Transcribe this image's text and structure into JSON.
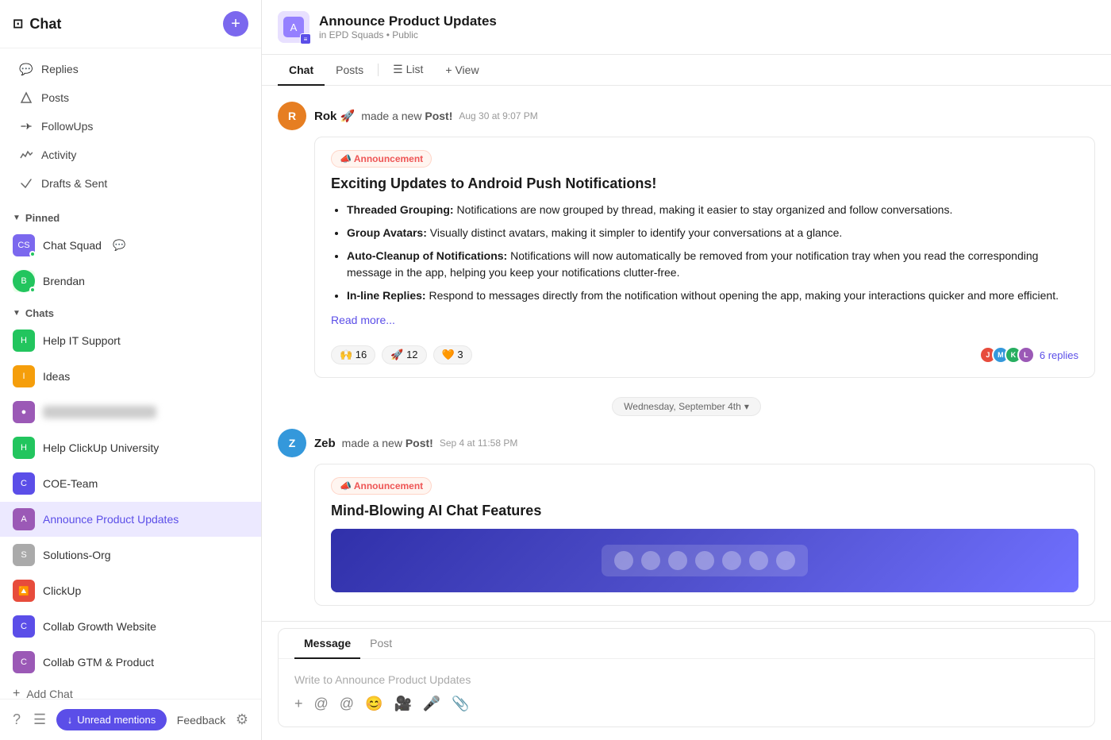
{
  "sidebar": {
    "title": "Chat",
    "add_button_label": "+",
    "nav_items": [
      {
        "id": "replies",
        "label": "Replies",
        "icon": "💬"
      },
      {
        "id": "posts",
        "label": "Posts",
        "icon": "△"
      },
      {
        "id": "followups",
        "label": "FollowUps",
        "icon": "⇄"
      },
      {
        "id": "activity",
        "label": "Activity",
        "icon": "📈"
      },
      {
        "id": "drafts",
        "label": "Drafts & Sent",
        "icon": "➤"
      }
    ],
    "pinned_section": "Pinned",
    "pinned_items": [
      {
        "id": "chat-squad",
        "label": "Chat Squad",
        "icon": "👤",
        "color": "#7b68ee"
      },
      {
        "id": "brendan",
        "label": "Brendan",
        "icon": "👤",
        "color": "#22c55e"
      }
    ],
    "chats_section": "Chats",
    "chat_items": [
      {
        "id": "help-it",
        "label": "Help IT Support",
        "icon": "🔧",
        "color": "#22c55e"
      },
      {
        "id": "ideas",
        "label": "Ideas",
        "icon": "💡",
        "color": "#f59e0b"
      },
      {
        "id": "blurred",
        "label": "██████ ████████",
        "blurred": true,
        "icon": "●",
        "color": "#9b59b6"
      },
      {
        "id": "help-clickup",
        "label": "Help ClickUp University",
        "icon": "🎓",
        "color": "#22c55e"
      },
      {
        "id": "coe-team",
        "label": "COE-Team",
        "icon": "⚙",
        "color": "#5b4ee8"
      },
      {
        "id": "announce",
        "label": "Announce Product Updates",
        "icon": "📢",
        "color": "#9b59b6",
        "active": true
      },
      {
        "id": "solutions",
        "label": "Solutions-Org",
        "icon": "📋",
        "color": "#aaa"
      },
      {
        "id": "clickup",
        "label": "ClickUp",
        "icon": "🔼",
        "color": "#e74c3c"
      },
      {
        "id": "collab-growth",
        "label": "Collab Growth Website",
        "icon": "🌐",
        "color": "#5b4ee8"
      },
      {
        "id": "collab-gtm",
        "label": "Collab GTM & Product",
        "icon": "📊",
        "color": "#9b59b6"
      }
    ],
    "add_chat_label": "Add Chat",
    "footer": {
      "feedback_label": "Feedback",
      "unread_mentions_label": "Unread mentions",
      "unread_arrow": "↓"
    }
  },
  "channel": {
    "name": "Announce Product Updates",
    "sub": "in EPD Squads • Public",
    "tabs": [
      "Chat",
      "Posts",
      "List",
      "View"
    ],
    "active_tab": "Chat"
  },
  "messages": [
    {
      "id": "msg1",
      "author": "Rok 🚀",
      "action": "made a new Post!",
      "time": "Aug 30 at 9:07 PM",
      "avatar_color": "#e67e22",
      "avatar_initials": "R",
      "post": {
        "badge": "📣 Announcement",
        "title": "Exciting Updates to Android Push Notifications!",
        "items": [
          {
            "bold": "Threaded Grouping:",
            "text": " Notifications are now grouped by thread, making it easier to stay organized and follow conversations."
          },
          {
            "bold": "Group Avatars:",
            "text": " Visually distinct avatars, making it simpler to identify your conversations at a glance."
          },
          {
            "bold": "Auto-Cleanup of Notifications:",
            "text": " Notifications will now automatically be removed from your notification tray when you read the corresponding message in the app, helping you keep your notifications clutter-free."
          },
          {
            "bold": "In-line Replies:",
            "text": " Respond to messages directly from the notification without opening the app, making your interactions quicker and more efficient."
          }
        ],
        "read_more": "Read more...",
        "reactions": [
          {
            "emoji": "🙌",
            "count": "16"
          },
          {
            "emoji": "🚀",
            "count": "12"
          },
          {
            "emoji": "🧡",
            "count": "3"
          }
        ],
        "replies": {
          "count": "6 replies",
          "avatars": [
            "#e74c3c",
            "#3498db",
            "#27ae60",
            "#9b59b6"
          ]
        }
      }
    },
    {
      "id": "msg2",
      "author": "Zeb",
      "action": "made a new Post!",
      "time": "Sep 4 at 11:58 PM",
      "avatar_color": "#3498db",
      "avatar_initials": "Z",
      "post": {
        "badge": "📣 Announcement",
        "title": "Mind-Blowing AI Chat Features",
        "has_image": true
      }
    }
  ],
  "date_divider": "Wednesday, September 4th",
  "input": {
    "message_tab": "Message",
    "post_tab": "Post",
    "placeholder": "Write to Announce Product Updates",
    "toolbar_icons": [
      "👍",
      "😊",
      "💬",
      "⬇",
      "⚡",
      "●",
      "😀",
      "⋯"
    ]
  }
}
